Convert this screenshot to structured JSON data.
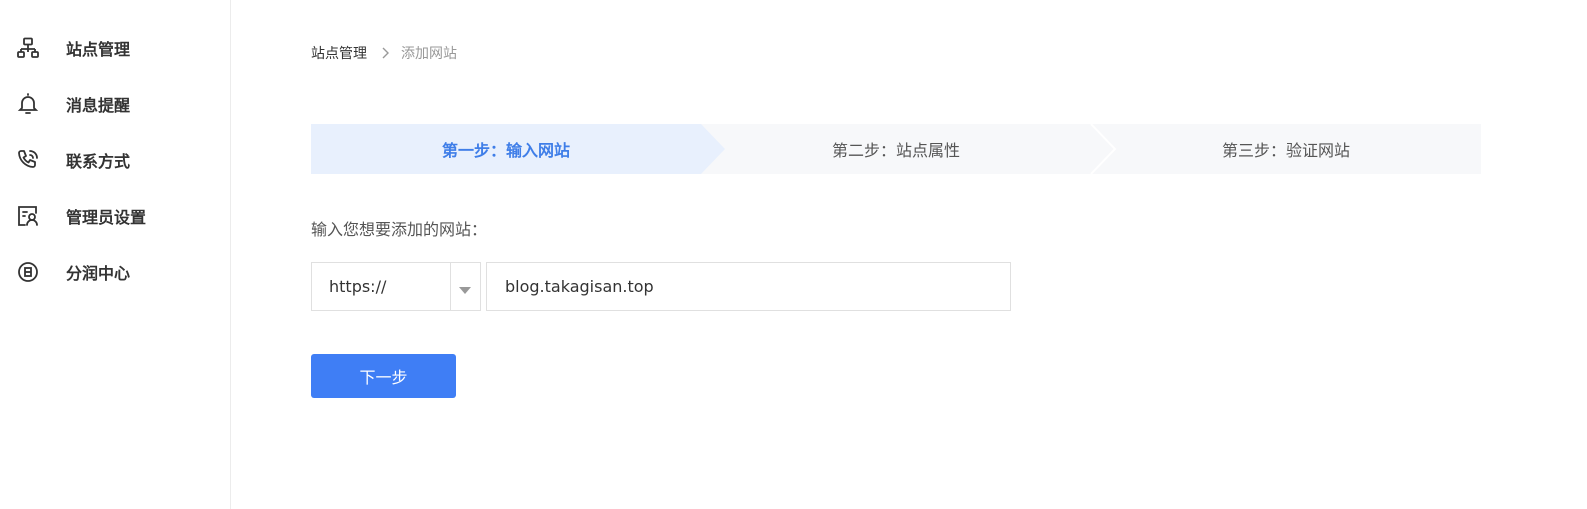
{
  "sidebar": {
    "items": [
      {
        "label": "站点管理",
        "icon": "sitemap-icon"
      },
      {
        "label": "消息提醒",
        "icon": "bell-icon"
      },
      {
        "label": "联系方式",
        "icon": "phone-icon"
      },
      {
        "label": "管理员设置",
        "icon": "admin-user-icon"
      },
      {
        "label": "分润中心",
        "icon": "profit-icon"
      }
    ]
  },
  "breadcrumb": {
    "parent": "站点管理",
    "current": "添加网站"
  },
  "steps": [
    {
      "label": "第一步：输入网站",
      "active": true
    },
    {
      "label": "第二步：站点属性",
      "active": false
    },
    {
      "label": "第三步：验证网站",
      "active": false
    }
  ],
  "form": {
    "prompt": "输入您想要添加的网站：",
    "protocol": "https://",
    "site_value": "blog.takagisan.top",
    "next_label": "下一步"
  },
  "colors": {
    "accent": "#3f7ef5",
    "active_step_bg": "#e8f0fd",
    "step_bg": "#f7f8fa"
  }
}
